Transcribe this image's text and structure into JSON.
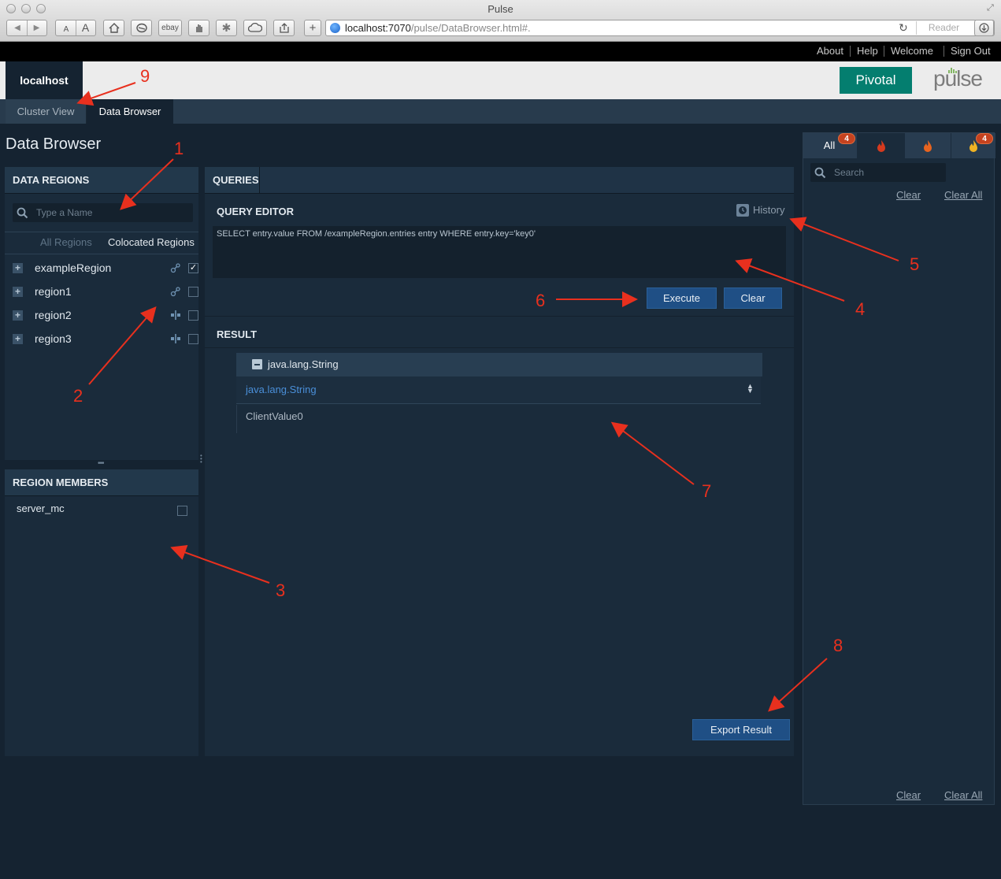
{
  "window": {
    "title": "Pulse"
  },
  "toolbar": {
    "url_host": "localhost:7070",
    "url_path": "/pulse/DataBrowser.html#.",
    "reader_label": "Reader",
    "font_small": "A",
    "font_large": "A",
    "ebay_label": "ebay"
  },
  "topnav": {
    "about": "About",
    "help": "Help",
    "welcome": "Welcome",
    "signout": "Sign Out"
  },
  "header": {
    "host": "localhost",
    "brand": "Pivotal",
    "product": "pulse"
  },
  "tabs": [
    {
      "label": "Cluster View"
    },
    {
      "label": "Data Browser"
    }
  ],
  "page": {
    "title": "Data Browser"
  },
  "regions_panel": {
    "title": "DATA REGIONS",
    "search_placeholder": "Type a Name",
    "subtab_all": "All Regions",
    "subtab_colocated": "Colocated Regions",
    "items": [
      {
        "name": "exampleRegion",
        "type_icon": "replicated-icon",
        "checked": true
      },
      {
        "name": "region1",
        "type_icon": "replicated-icon",
        "checked": false
      },
      {
        "name": "region2",
        "type_icon": "partitioned-icon",
        "checked": false
      },
      {
        "name": "region3",
        "type_icon": "partitioned-icon",
        "checked": false
      }
    ]
  },
  "members_panel": {
    "title": "REGION MEMBERS",
    "members": [
      {
        "name": "server_mc",
        "checked": false
      }
    ]
  },
  "queries": {
    "tab": "QUERIES",
    "editor_title": "QUERY EDITOR",
    "history_label": "History",
    "query_text": "SELECT entry.value FROM /exampleRegion.entries entry WHERE entry.key='key0'",
    "execute_label": "Execute",
    "clear_label": "Clear",
    "result_title": "RESULT",
    "result_group": "java.lang.String",
    "result_column": "java.lang.String",
    "result_values": [
      "ClientValue0"
    ],
    "export_label": "Export Result"
  },
  "alerts": {
    "tab_all": "All",
    "all_count": "4",
    "warning_count": "4",
    "search_placeholder": "Search",
    "clear_label": "Clear",
    "clear_all_label": "Clear All",
    "colors": {
      "severe": "#d63a1e",
      "error": "#e8641f",
      "warning": "#f0b323"
    }
  },
  "annotations": [
    "1",
    "2",
    "3",
    "4",
    "5",
    "6",
    "7",
    "8",
    "9"
  ]
}
